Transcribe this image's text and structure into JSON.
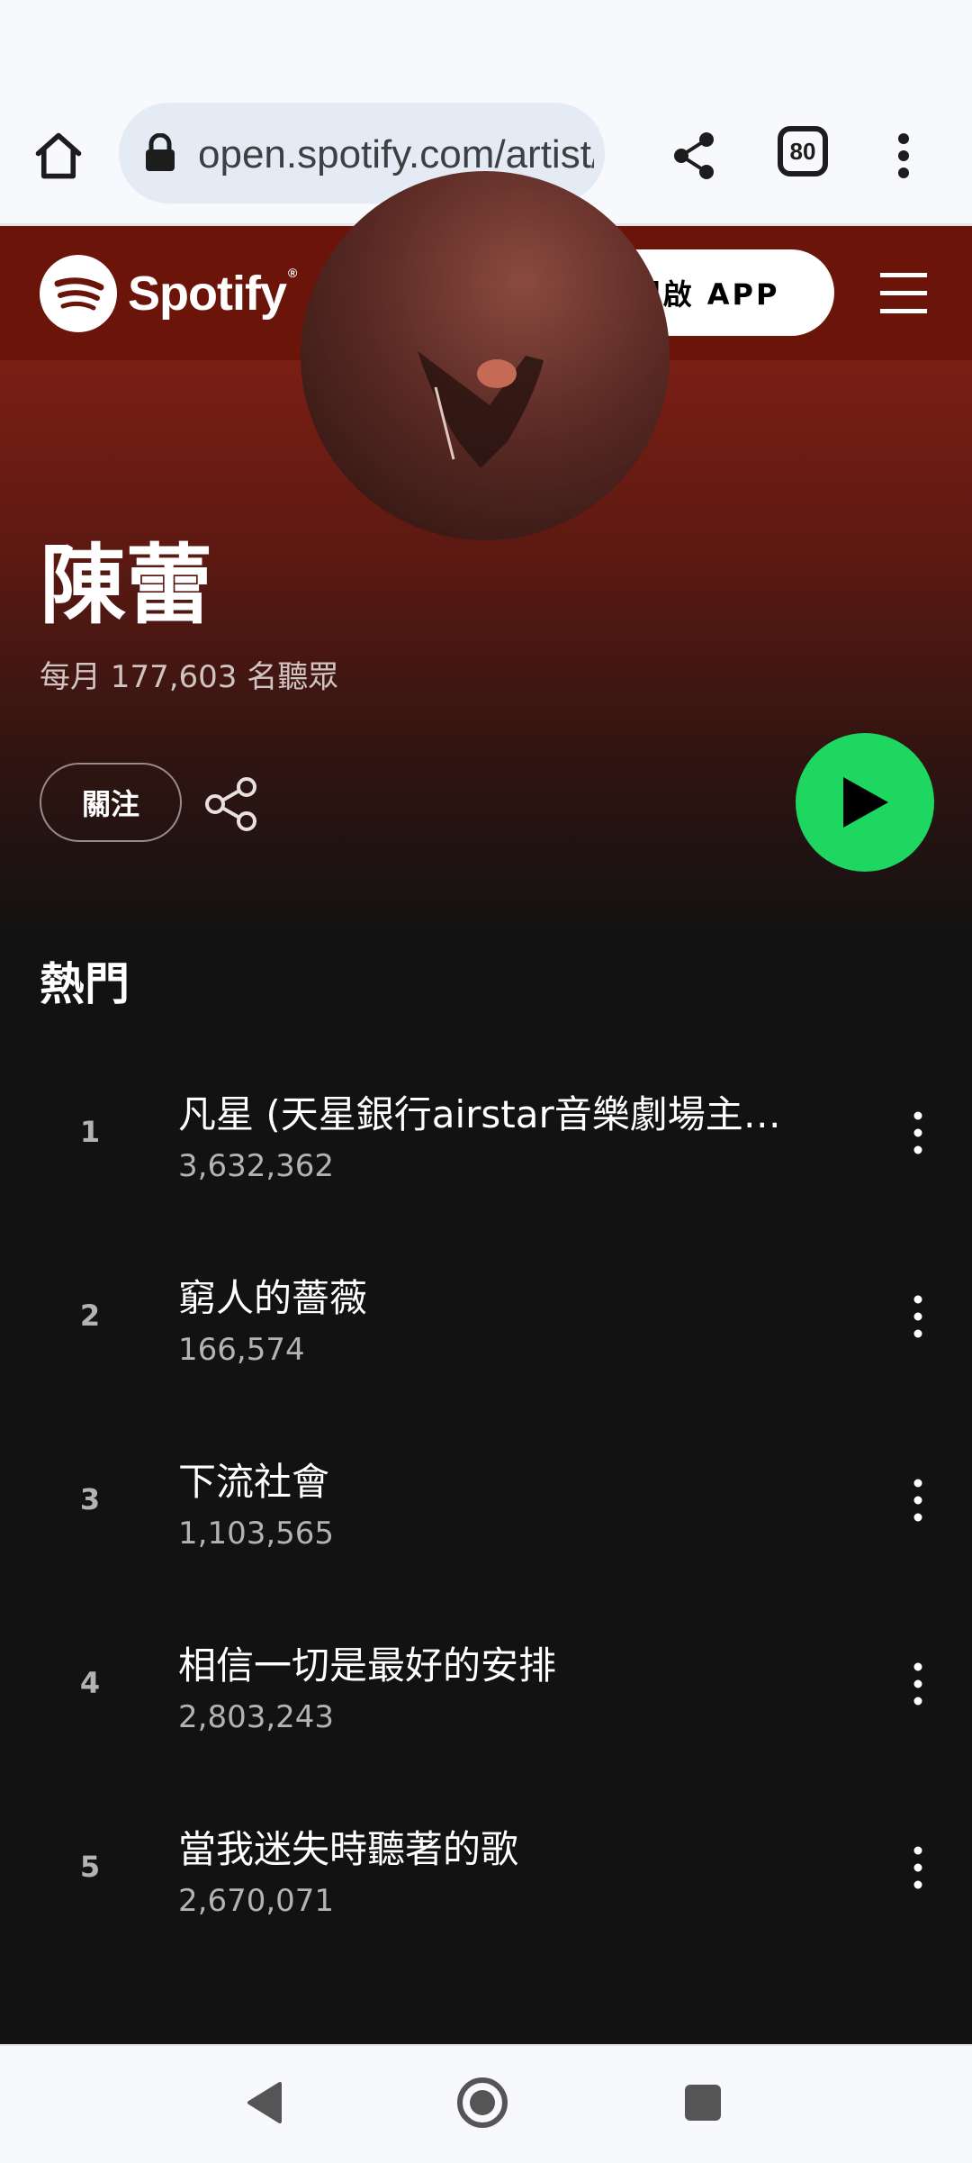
{
  "browser": {
    "url": "open.spotify.com/artist/",
    "tab_count": "80"
  },
  "header": {
    "brand": "Spotify",
    "brand_mark": "®",
    "open_app_label": "開啟 APP"
  },
  "artist": {
    "name": "陳蕾",
    "monthly_listeners": "每月 177,603 名聽眾",
    "follow_label": "關注"
  },
  "popular": {
    "heading": "熱門",
    "tracks": [
      {
        "rank": "1",
        "title": "凡星 (天星銀行airstar音樂劇場主…",
        "plays": "3,632,362"
      },
      {
        "rank": "2",
        "title": "窮人的薔薇",
        "plays": "166,574"
      },
      {
        "rank": "3",
        "title": "下流社會",
        "plays": "1,103,565"
      },
      {
        "rank": "4",
        "title": "相信一切是最好的安排",
        "plays": "2,803,243"
      },
      {
        "rank": "5",
        "title": "當我迷失時聽著的歌",
        "plays": "2,670,071"
      }
    ]
  },
  "colors": {
    "header_bg": "#6b140a",
    "accent_green": "#1ed760",
    "page_bg": "#121212"
  },
  "icons": [
    "home-icon",
    "lock-icon",
    "share-icon",
    "tabs-icon",
    "more-vert-icon",
    "spotify-logo-icon",
    "search-icon",
    "hamburger-icon",
    "play-icon",
    "back-icon",
    "home-circle-icon",
    "recents-icon"
  ]
}
